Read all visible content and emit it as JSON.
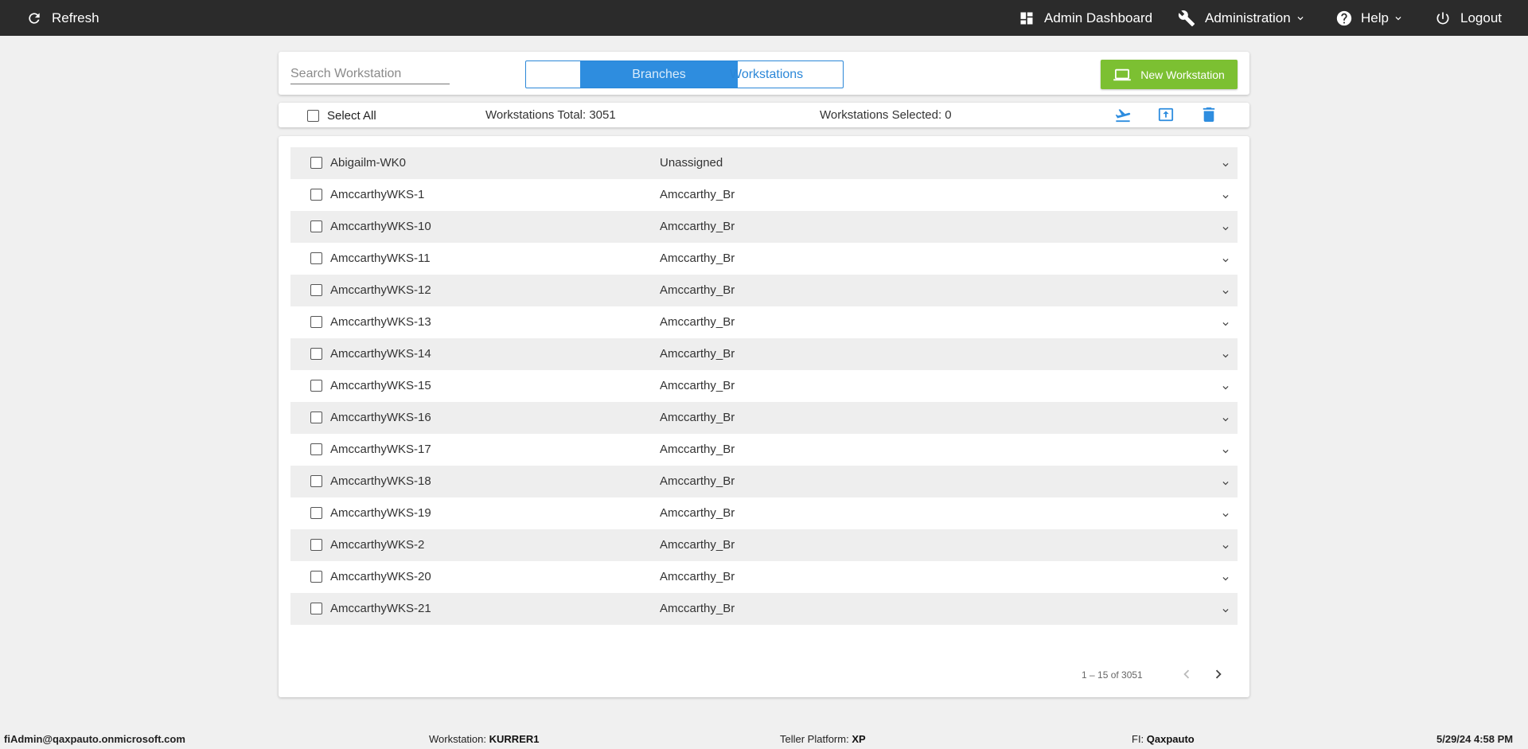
{
  "topbar": {
    "refresh": "Refresh",
    "admin_dashboard": "Admin Dashboard",
    "administration": "Administration",
    "help": "Help",
    "logout": "Logout"
  },
  "search": {
    "placeholder": "Search Workstation",
    "value": ""
  },
  "view_toggle": {
    "branches": "Branches",
    "workstations": "Workstations",
    "active": "branches"
  },
  "new_workstation_label": "New Workstation",
  "toolbar": {
    "select_all": "Select All",
    "total_label": "Workstations Total: 3051",
    "selected_label": "Workstations Selected: 0"
  },
  "rows": [
    {
      "name": "Abigailm-WK0",
      "branch": "Unassigned"
    },
    {
      "name": "AmccarthyWKS-1",
      "branch": "Amccarthy_Br"
    },
    {
      "name": "AmccarthyWKS-10",
      "branch": "Amccarthy_Br"
    },
    {
      "name": "AmccarthyWKS-11",
      "branch": "Amccarthy_Br"
    },
    {
      "name": "AmccarthyWKS-12",
      "branch": "Amccarthy_Br"
    },
    {
      "name": "AmccarthyWKS-13",
      "branch": "Amccarthy_Br"
    },
    {
      "name": "AmccarthyWKS-14",
      "branch": "Amccarthy_Br"
    },
    {
      "name": "AmccarthyWKS-15",
      "branch": "Amccarthy_Br"
    },
    {
      "name": "AmccarthyWKS-16",
      "branch": "Amccarthy_Br"
    },
    {
      "name": "AmccarthyWKS-17",
      "branch": "Amccarthy_Br"
    },
    {
      "name": "AmccarthyWKS-18",
      "branch": "Amccarthy_Br"
    },
    {
      "name": "AmccarthyWKS-19",
      "branch": "Amccarthy_Br"
    },
    {
      "name": "AmccarthyWKS-2",
      "branch": "Amccarthy_Br"
    },
    {
      "name": "AmccarthyWKS-20",
      "branch": "Amccarthy_Br"
    },
    {
      "name": "AmccarthyWKS-21",
      "branch": "Amccarthy_Br"
    }
  ],
  "pagination": {
    "range": "1 – 15 of 3051"
  },
  "footer": {
    "user": "fiAdmin@qaxpauto.onmicrosoft.com",
    "workstation_label": "Workstation:",
    "workstation_value": "KURRER1",
    "teller_label": "Teller Platform:",
    "teller_value": "XP",
    "fi_label": "FI:",
    "fi_value": "Qaxpauto",
    "datetime": "5/29/24 4:58 PM"
  },
  "colors": {
    "topbar": "#2b2b2b",
    "accent_blue": "#2e8ddf",
    "new_button_green": "#7cc032",
    "row_shade": "#eeeeee"
  },
  "icons": {
    "refresh": "refresh-icon",
    "admin_dashboard": "dashboard-icon",
    "administration": "wrench-icon",
    "help": "help-icon",
    "logout": "power-icon",
    "new_workstation": "laptop-icon",
    "move": "airplane-icon",
    "upload": "upload-icon",
    "delete": "trash-icon",
    "expand": "chevron-down-icon"
  }
}
